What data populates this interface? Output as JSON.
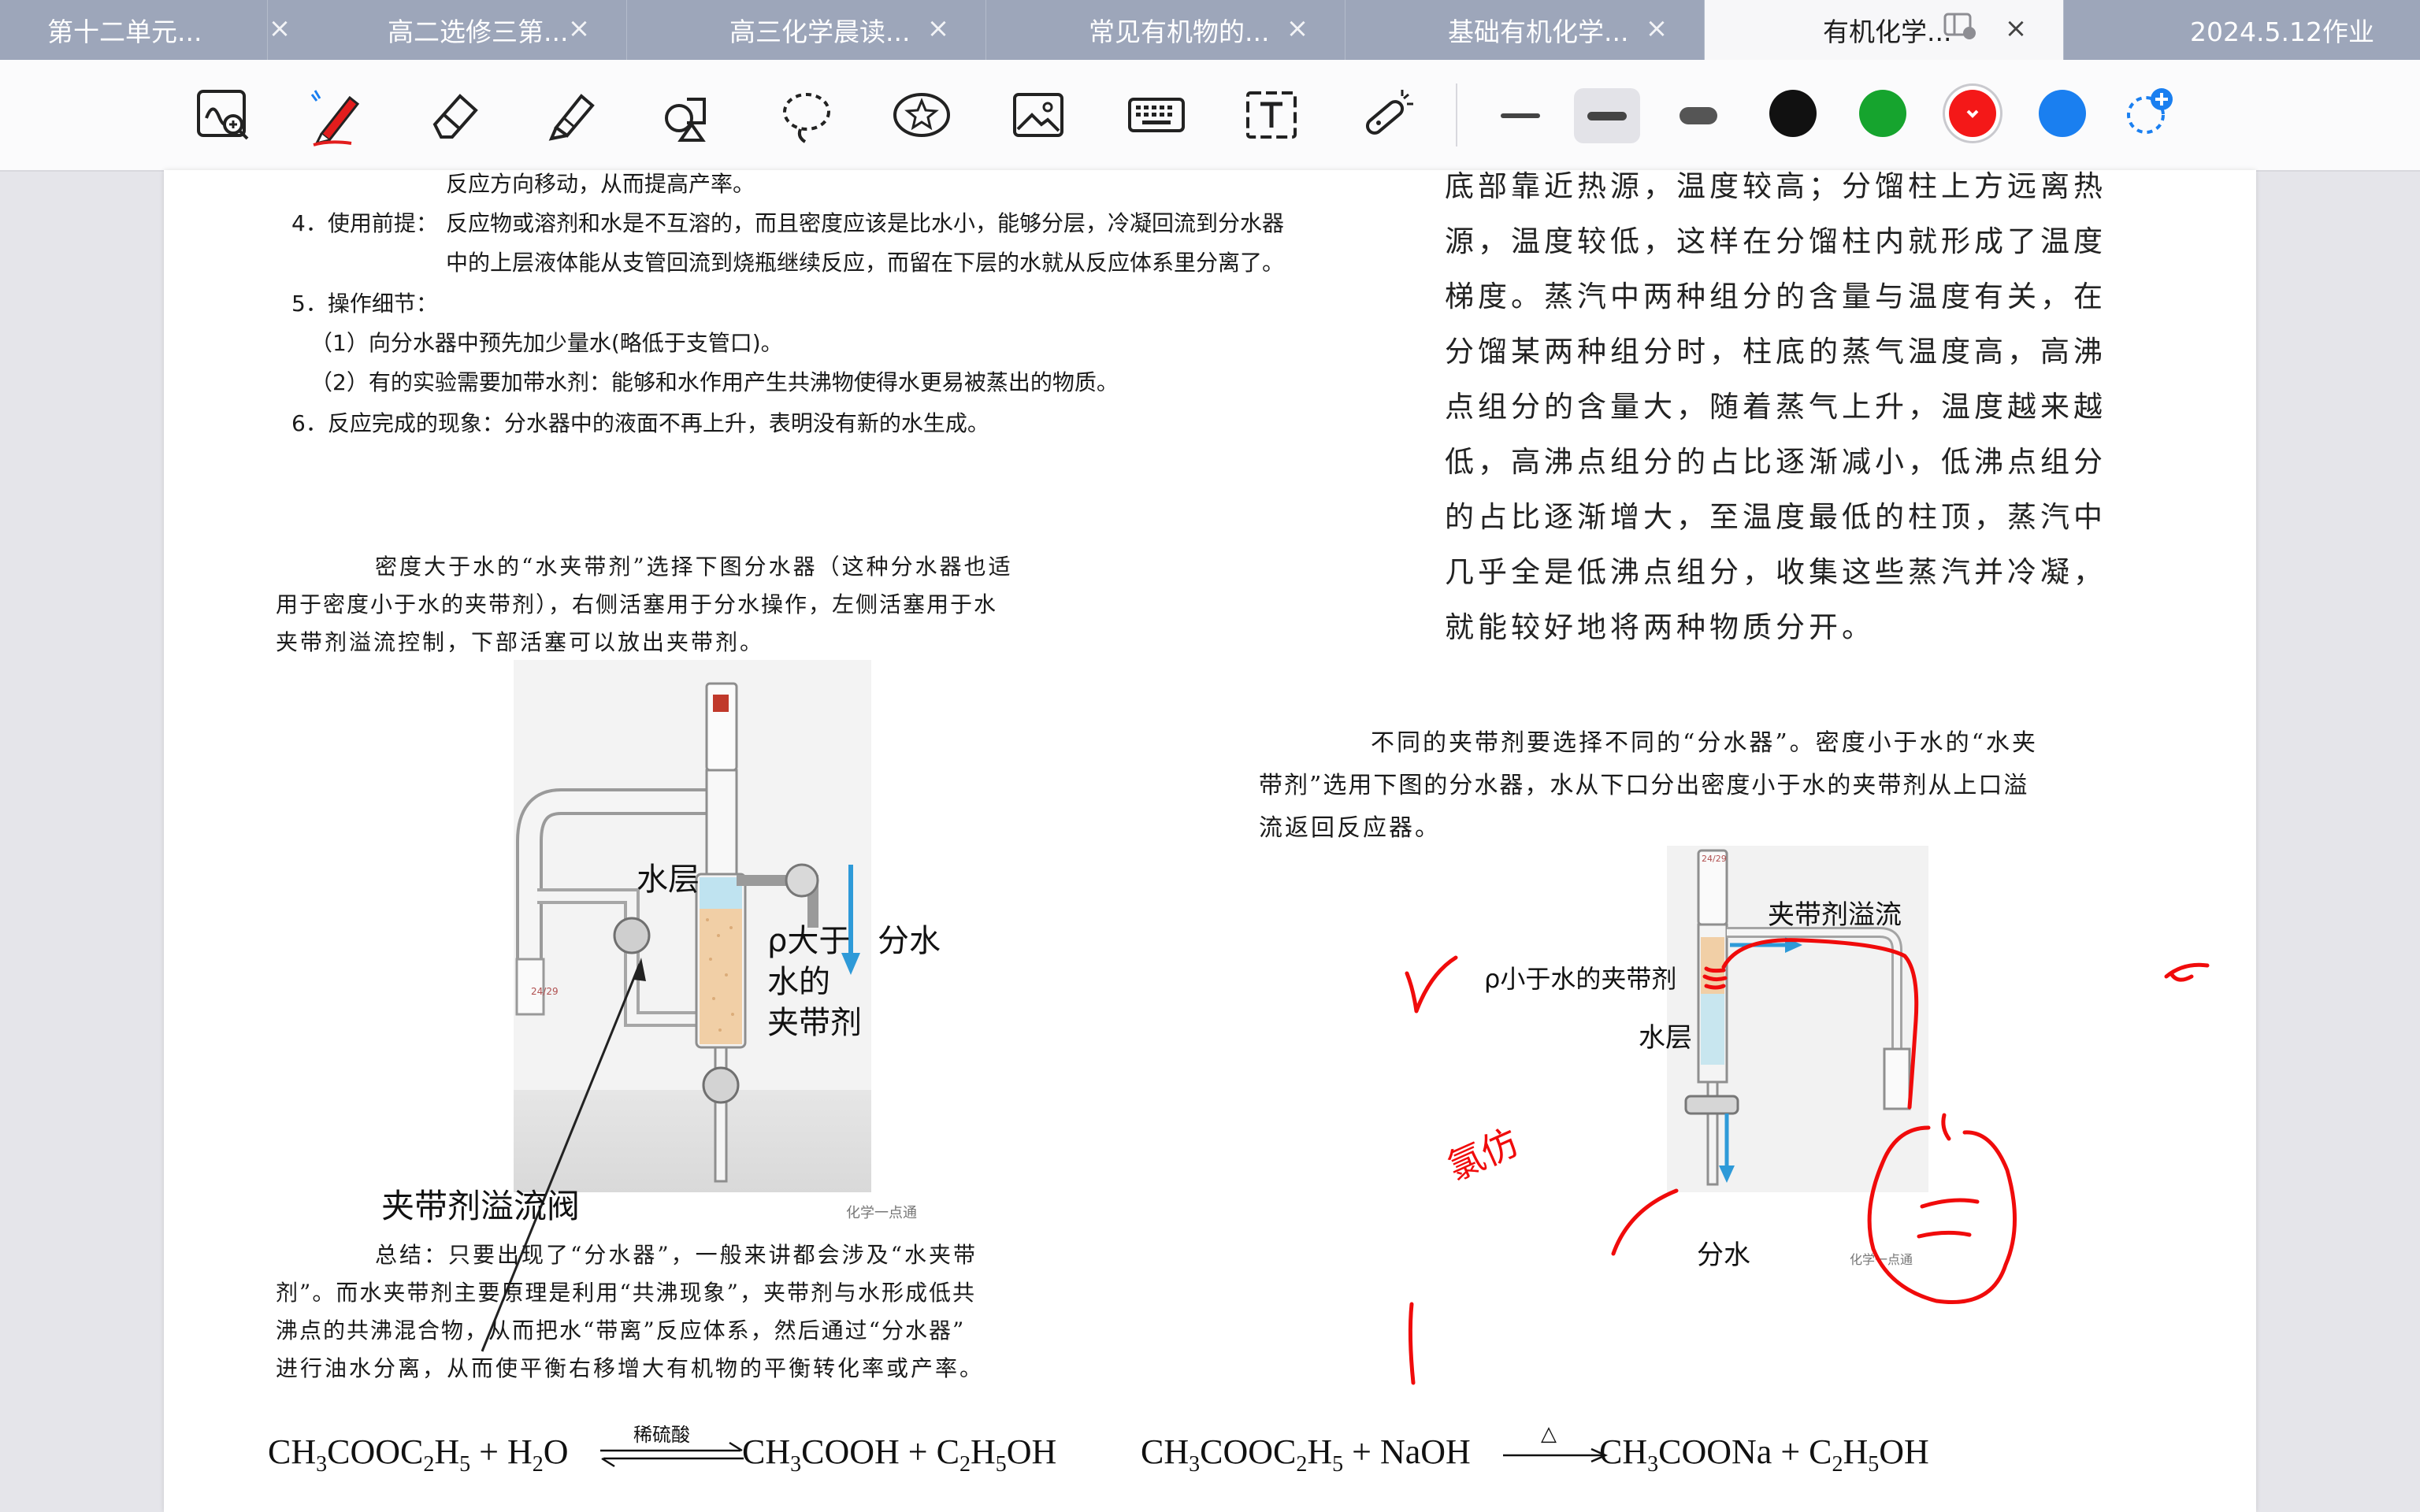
{
  "tabs": [
    {
      "title": "第十二单元...",
      "active": false
    },
    {
      "title": "高二选修三第...",
      "active": false
    },
    {
      "title": "高三化学晨读...",
      "active": false
    },
    {
      "title": "常见有机物的...",
      "active": false
    },
    {
      "title": "基础有机化学...",
      "active": false
    },
    {
      "title": "有机化学...",
      "active": true
    },
    {
      "title": "2024.5.12作业",
      "active": false
    }
  ],
  "toolbar": {
    "tools": [
      "lasso-zoom-icon",
      "pen-icon",
      "eraser-icon",
      "highlighter-icon",
      "shapes-icon",
      "lasso-icon",
      "sticker-icon",
      "image-icon",
      "keyboard-icon",
      "text-box-icon",
      "laser-pointer-icon"
    ],
    "stroke_widths": [
      "thin",
      "medium",
      "thick"
    ],
    "selected_stroke": "medium",
    "colors": [
      "#111111",
      "#16a42e",
      "#f41818",
      "#1a7ff0"
    ],
    "selected_color": "#f41818",
    "accent": "#1a7ff0"
  },
  "doc": {
    "left_top": {
      "line0": "反应方向移动，从而提高产率。",
      "p4_label": "4．使用前提：",
      "p4_text1": "反应物或溶剂和水是不互溶的，而且密度应该是比水小，能够分层，冷凝回流到分水器",
      "p4_text2": "中的上层液体能从支管回流到烧瓶继续反应，而留在下层的水就从反应体系里分离了。",
      "p5_label": "5．操作细节：",
      "p5_1": "（1）向分水器中预先加少量水(略低于支管口)。",
      "p5_2": "（2）有的实验需要加带水剂：能够和水作用产生共沸物使得水更易被蒸出的物质。",
      "p6": "6．反应完成的现象：分水器中的液面不再上升，表明没有新的水生成。"
    },
    "right_top": [
      "底部靠近热源，温度较高；分馏柱上方远离热",
      "源，温度较低，这样在分馏柱内就形成了温度",
      "梯度。蒸汽中两种组分的含量与温度有关，在",
      "分馏某两种组分时，柱底的蒸气温度高，高沸",
      "点组分的含量大，随着蒸气上升，温度越来越",
      "低，高沸点组分的占比逐渐减小，低沸点组分",
      "的占比逐渐增大，至温度最低的柱顶，蒸汽中",
      "几乎全是低沸点组分，收集这些蒸汽并冷凝，",
      "就能较好地将两种物质分开。"
    ],
    "left_intro": [
      "密度大于水的“水夹带剂”选择下图分水器（这种分水器也适",
      "用于密度小于水的夹带剂），右侧活塞用于分水操作，左侧活塞用于水",
      "夹带剂溢流控制，下部活塞可以放出夹带剂。"
    ],
    "left_figure": {
      "water_layer": "水层",
      "dense1": "ρ大于",
      "dense2": "水的",
      "dense3": "夹带剂",
      "drain": "分水",
      "valve": "夹带剂溢流阀",
      "watermark": "化学一点通",
      "joint": "24/29"
    },
    "summary": [
      "总结：只要出现了“分水器”，一般来讲都会涉及“水夹带",
      "剂”。而水夹带剂主要原理是利用“共沸现象”，夹带剂与水形成低共",
      "沸点的共沸混合物，从而把水“带离”反应体系，然后通过“分水器”",
      "进行油水分离，从而使平衡右移增大有机物的平衡转化率或产率。"
    ],
    "right_intro": [
      "不同的夹带剂要选择不同的“分水器”。密度小于水的“水夹",
      "带剂”选用下图的分水器，水从下口分出密度小于水的夹带剂从上口溢",
      "流返回反应器。"
    ],
    "right_figure": {
      "overflow": "夹带剂溢流",
      "light": "ρ小于水的夹带剂",
      "water_layer": "水层",
      "drain": "分水",
      "watermark": "化学一点通",
      "joint": "24/29"
    },
    "handwriting": {
      "chloroform": "氯仿"
    },
    "eq1": {
      "a": "CH",
      "a_sub": "3",
      "b": "COOC",
      "b_sub": "2",
      "c": "H",
      "c_sub": "5",
      "plus1": " + H",
      "h2o_sub": "2",
      "o": "O",
      "catalyst": "稀硫酸",
      "p1": "CH",
      "p1_sub": "3",
      "p2": "COOH + C",
      "p2_sub": "2",
      "p3": "H",
      "p3_sub": "5",
      "p4": "OH"
    },
    "eq2": {
      "a": "CH",
      "a_sub": "3",
      "b": "COOC",
      "b_sub": "2",
      "c": "H",
      "c_sub": "5",
      "plus1": " + NaOH",
      "condition": "△",
      "p1": "CH",
      "p1_sub": "3",
      "p2": "COONa + C",
      "p2_sub": "2",
      "p3": "H",
      "p3_sub": "5",
      "p4": "OH"
    }
  }
}
